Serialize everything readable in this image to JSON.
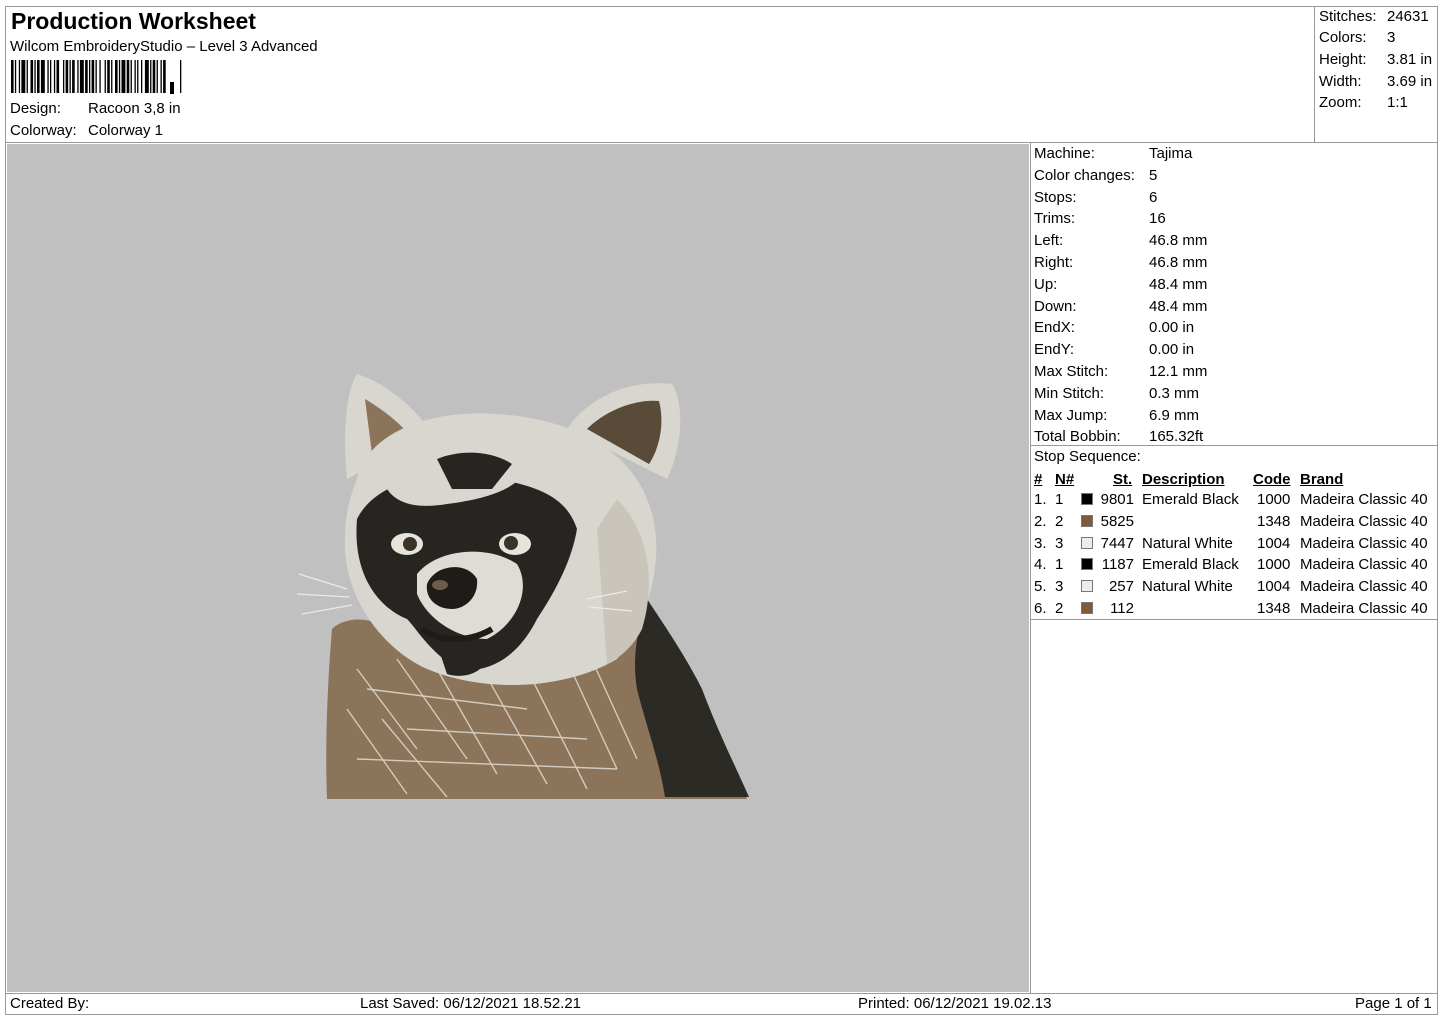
{
  "header": {
    "title": "Production Worksheet",
    "software": "Wilcom EmbroideryStudio – Level 3 Advanced",
    "design_label": "Design:",
    "design_value": "Racoon 3,8 in",
    "colorway_label": "Colorway:",
    "colorway_value": "Colorway 1"
  },
  "stats": [
    {
      "label": "Stitches:",
      "value": "24631"
    },
    {
      "label": "Colors:",
      "value": "3"
    },
    {
      "label": "Height:",
      "value": "3.81 in"
    },
    {
      "label": "Width:",
      "value": "3.69 in"
    },
    {
      "label": "Zoom:",
      "value": "1:1"
    }
  ],
  "machine_info": [
    {
      "label": "Machine:",
      "value": "Tajima"
    },
    {
      "label": "Color changes:",
      "value": "5"
    },
    {
      "label": "Stops:",
      "value": "6"
    },
    {
      "label": "Trims:",
      "value": "16"
    },
    {
      "label": "Left:",
      "value": "46.8 mm"
    },
    {
      "label": "Right:",
      "value": "46.8 mm"
    },
    {
      "label": "Up:",
      "value": "48.4 mm"
    },
    {
      "label": "Down:",
      "value": "48.4 mm"
    },
    {
      "label": "EndX:",
      "value": "0.00 in"
    },
    {
      "label": "EndY:",
      "value": "0.00 in"
    },
    {
      "label": "Max Stitch:",
      "value": "12.1 mm"
    },
    {
      "label": "Min Stitch:",
      "value": "0.3 mm"
    },
    {
      "label": "Max Jump:",
      "value": "6.9 mm"
    },
    {
      "label": "Total Bobbin:",
      "value": "165.32ft"
    }
  ],
  "stop_sequence": {
    "title": "Stop Sequence:",
    "columns": {
      "num": "#",
      "n_num": "N#",
      "st": "St.",
      "description": "Description",
      "code": "Code",
      "brand": "Brand"
    },
    "rows": [
      {
        "num": "1.",
        "n": "1",
        "color": "#000000",
        "st": "9801",
        "description": "Emerald Black",
        "code": "1000",
        "brand": "Madeira Classic 40"
      },
      {
        "num": "2.",
        "n": "2",
        "color": "#7d5b3b",
        "st": "5825",
        "description": "",
        "code": "1348",
        "brand": "Madeira Classic 40"
      },
      {
        "num": "3.",
        "n": "3",
        "color": "#ecebf0",
        "st": "7447",
        "description": "Natural White",
        "code": "1004",
        "brand": "Madeira Classic 40"
      },
      {
        "num": "4.",
        "n": "1",
        "color": "#000000",
        "st": "1187",
        "description": "Emerald Black",
        "code": "1000",
        "brand": "Madeira Classic 40"
      },
      {
        "num": "5.",
        "n": "3",
        "color": "#ecebf0",
        "st": "257",
        "description": "Natural White",
        "code": "1004",
        "brand": "Madeira Classic 40"
      },
      {
        "num": "6.",
        "n": "2",
        "color": "#7d5b3b",
        "st": "112",
        "description": "",
        "code": "1348",
        "brand": "Madeira Classic 40"
      }
    ]
  },
  "footer": {
    "created_by": "Created By:",
    "last_saved": "Last Saved: 06/12/2021 18.52.21",
    "printed": "Printed: 06/12/2021 19.02.13",
    "page": "Page 1 of 1"
  },
  "colors": {
    "canvas_background": "#c0c0c0",
    "border": "#9a9a9a"
  }
}
